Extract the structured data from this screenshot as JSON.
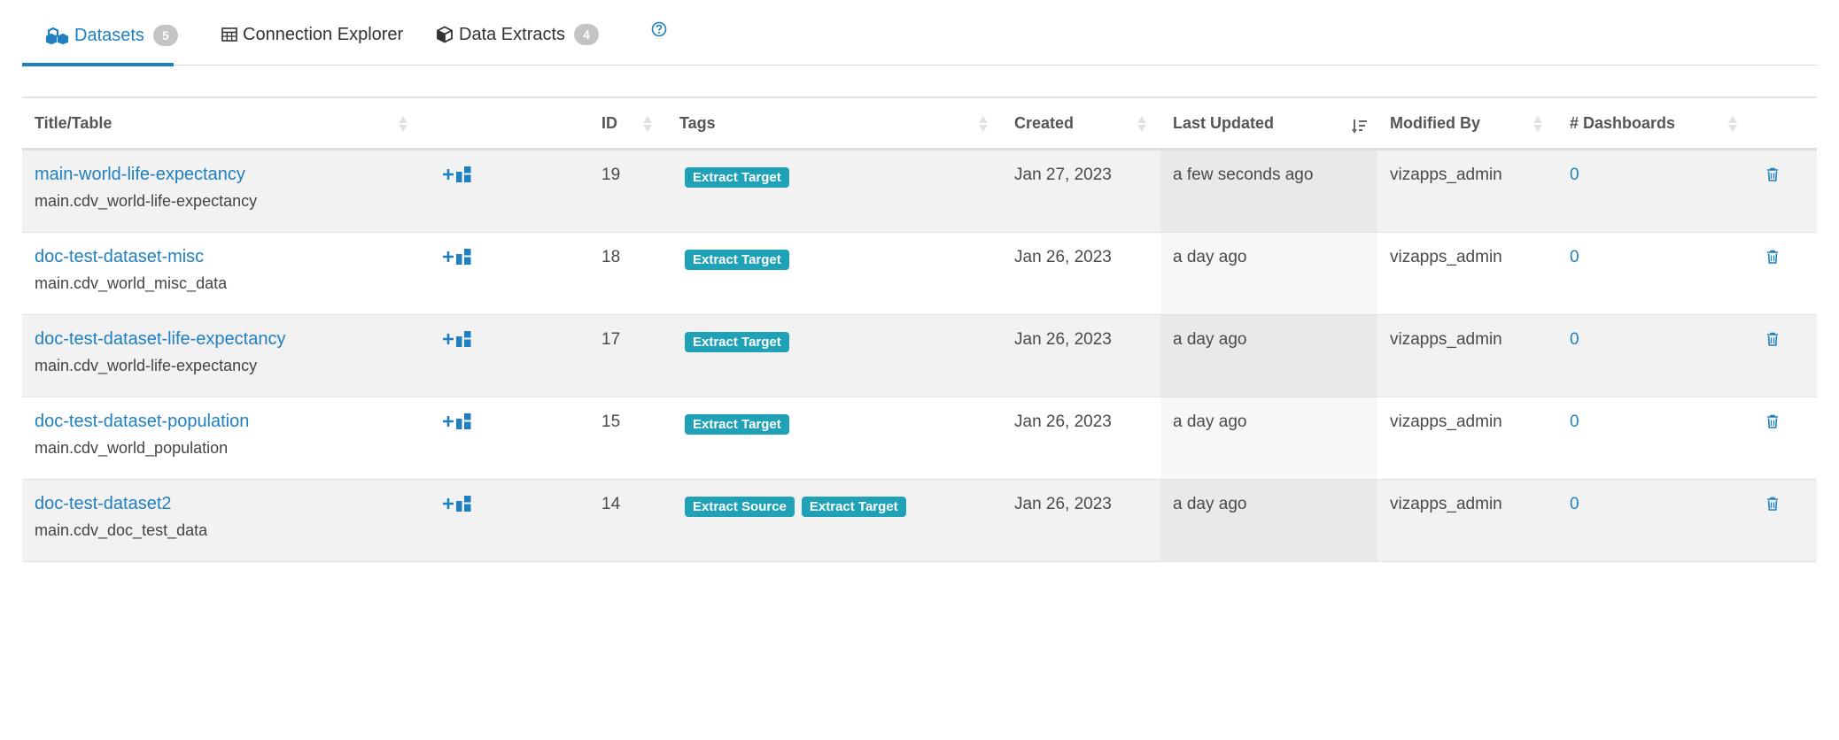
{
  "tabs": [
    {
      "label": "Datasets",
      "count": "5",
      "icon": "cubes-icon"
    },
    {
      "label": "Connection Explorer",
      "icon": "table-icon"
    },
    {
      "label": "Data Extracts",
      "count": "4",
      "icon": "cube-icon"
    },
    {
      "label": "",
      "icon": "help-icon"
    }
  ],
  "columns": {
    "title": "Title/Table",
    "id": "ID",
    "tags": "Tags",
    "created": "Created",
    "last_updated": "Last Updated",
    "modified_by": "Modified By",
    "dashboards": "# Dashboards"
  },
  "sort": {
    "column": "last_updated",
    "direction": "descending"
  },
  "rows": [
    {
      "title": "main-world-life-expectancy",
      "table": "main.cdv_world-life-expectancy",
      "id": "19",
      "tags": [
        "Extract Target"
      ],
      "created": "Jan 27, 2023",
      "last_updated": "a few seconds ago",
      "modified_by": "vizapps_admin",
      "dashboards": "0"
    },
    {
      "title": "doc-test-dataset-misc",
      "table": "main.cdv_world_misc_data",
      "id": "18",
      "tags": [
        "Extract Target"
      ],
      "created": "Jan 26, 2023",
      "last_updated": "a day ago",
      "modified_by": "vizapps_admin",
      "dashboards": "0"
    },
    {
      "title": "doc-test-dataset-life-expectancy",
      "table": "main.cdv_world-life-expectancy",
      "id": "17",
      "tags": [
        "Extract Target"
      ],
      "created": "Jan 26, 2023",
      "last_updated": "a day ago",
      "modified_by": "vizapps_admin",
      "dashboards": "0"
    },
    {
      "title": "doc-test-dataset-population",
      "table": "main.cdv_world_population",
      "id": "15",
      "tags": [
        "Extract Target"
      ],
      "created": "Jan 26, 2023",
      "last_updated": "a day ago",
      "modified_by": "vizapps_admin",
      "dashboards": "0"
    },
    {
      "title": "doc-test-dataset2",
      "table": "main.cdv_doc_test_data",
      "id": "14",
      "tags": [
        "Extract Source",
        "Extract Target"
      ],
      "created": "Jan 26, 2023",
      "last_updated": "a day ago",
      "modified_by": "vizapps_admin",
      "dashboards": "0"
    }
  ],
  "colors": {
    "accent": "#1e7fc1",
    "tag": "#1fa1b8",
    "badge": "#c4c4c4"
  }
}
